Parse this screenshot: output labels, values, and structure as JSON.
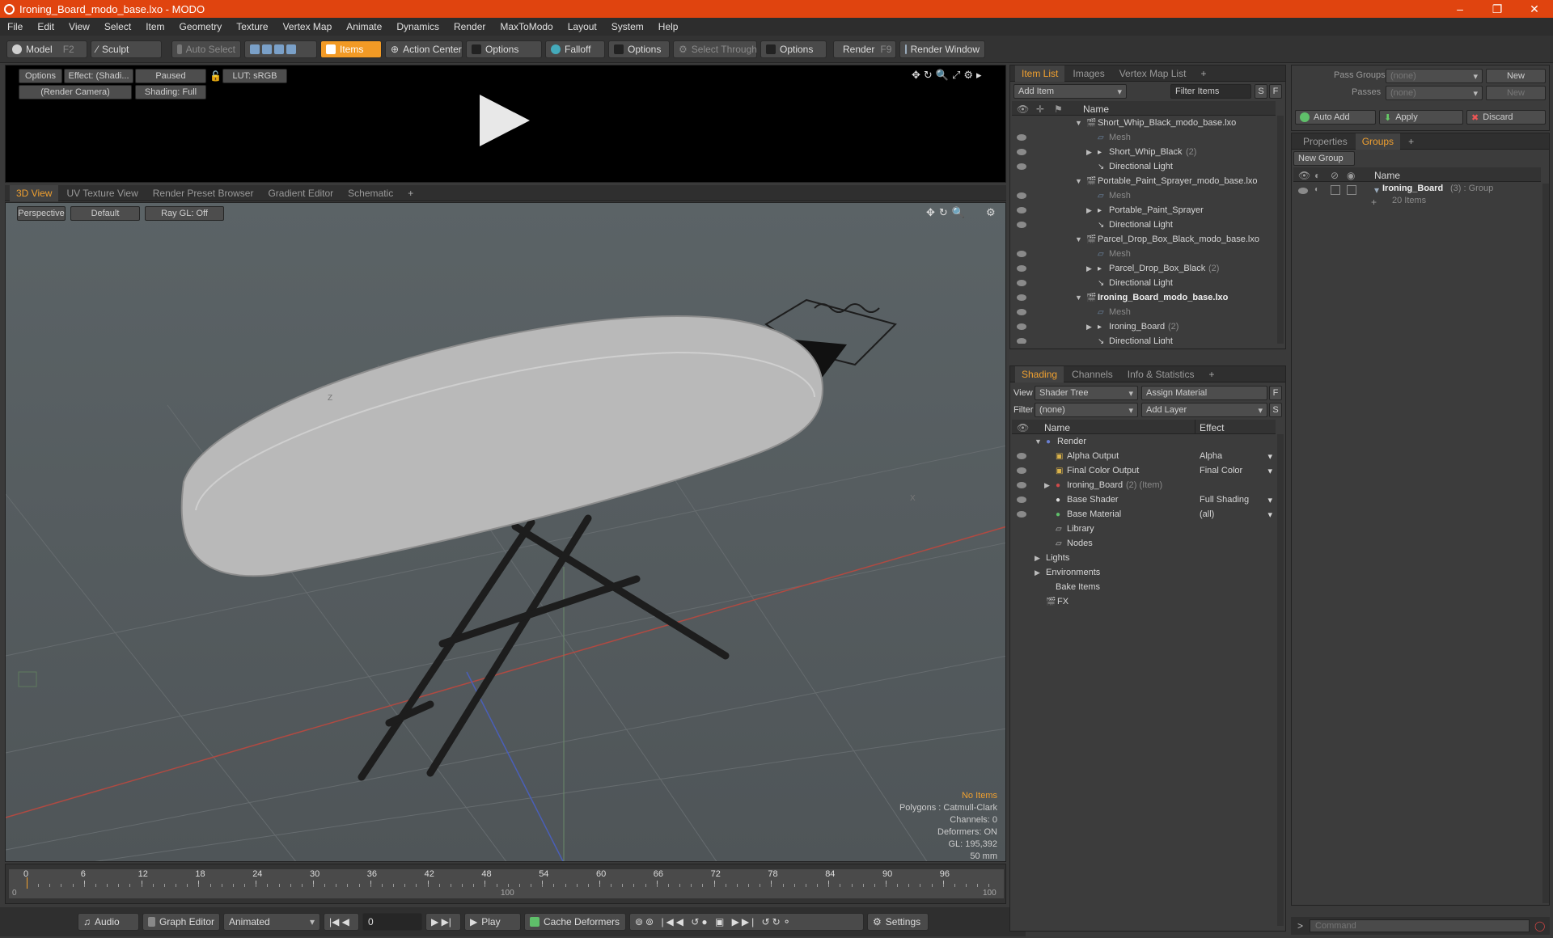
{
  "window": {
    "title": "Ironing_Board_modo_base.lxo - MODO",
    "min": "–",
    "max": "❐",
    "close": "✕"
  },
  "menu": [
    "File",
    "Edit",
    "View",
    "Select",
    "Item",
    "Geometry",
    "Texture",
    "Vertex Map",
    "Animate",
    "Dynamics",
    "Render",
    "MaxToModo",
    "Layout",
    "System",
    "Help"
  ],
  "toolbar": {
    "model": "Model",
    "model_key": "F2",
    "sculpt": "Sculpt",
    "auto_select": "Auto Select",
    "items": "Items",
    "action_center": "Action Center",
    "options1": "Options",
    "falloff": "Falloff",
    "options2": "Options",
    "select_through": "Select Through",
    "options3": "Options",
    "render": "Render",
    "render_key": "F9",
    "render_window": "Render Window"
  },
  "preview": {
    "options": "Options",
    "effect": "Effect: (Shadi...",
    "paused": "Paused",
    "lut": "LUT: sRGB",
    "camera": "(Render Camera)",
    "shading": "Shading: Full"
  },
  "viewport": {
    "tabs": [
      "3D View",
      "UV Texture View",
      "Render Preset Browser",
      "Gradient Editor",
      "Schematic"
    ],
    "plus": "+",
    "perspective": "Perspective",
    "default": "Default",
    "raygl": "Ray GL: Off",
    "axis_z": "Z",
    "axis_x": "X",
    "hud": {
      "no_items": "No Items",
      "polygons": "Polygons : Catmull-Clark",
      "channels": "Channels: 0",
      "deformers": "Deformers: ON",
      "gl": "GL: 195,392",
      "mm": "50 mm"
    }
  },
  "timeline": {
    "ticks": [
      "0",
      "6",
      "12",
      "18",
      "24",
      "30",
      "36",
      "42",
      "48",
      "54",
      "60",
      "66",
      "72",
      "78",
      "84",
      "90",
      "96"
    ],
    "bottom": [
      "0",
      "100",
      "100"
    ]
  },
  "bottombar": {
    "audio": "Audio",
    "graph_editor": "Graph Editor",
    "animated": "Animated",
    "frame": "0",
    "play": "Play",
    "cache": "Cache Deformers",
    "settings": "Settings"
  },
  "itemlist": {
    "tabs": [
      "Item List",
      "Images",
      "Vertex Map List"
    ],
    "plus": "+",
    "add_item": "Add Item",
    "filter": "Filter Items",
    "s": "S",
    "f": "F",
    "col_name": "Name",
    "rows": [
      {
        "label": "Short_Whip_Black_modo_base.lxo",
        "level": 0,
        "type": "scene",
        "expand": "▼"
      },
      {
        "label": "Mesh",
        "level": 1,
        "type": "mesh",
        "expand": ""
      },
      {
        "label": "Short_Whip_Black",
        "count": "(2)",
        "level": 1,
        "type": "group",
        "expand": "▶"
      },
      {
        "label": "Directional Light",
        "level": 1,
        "type": "light",
        "expand": ""
      },
      {
        "label": "Portable_Paint_Sprayer_modo_base.lxo",
        "level": 0,
        "type": "scene",
        "expand": "▼"
      },
      {
        "label": "Mesh",
        "level": 1,
        "type": "mesh",
        "expand": ""
      },
      {
        "label": "Portable_Paint_Sprayer",
        "level": 1,
        "type": "group",
        "expand": "▶"
      },
      {
        "label": "Directional Light",
        "level": 1,
        "type": "light",
        "expand": ""
      },
      {
        "label": "Parcel_Drop_Box_Black_modo_base.lxo",
        "level": 0,
        "type": "scene",
        "expand": "▼"
      },
      {
        "label": "Mesh",
        "level": 1,
        "type": "mesh",
        "expand": ""
      },
      {
        "label": "Parcel_Drop_Box_Black",
        "count": "(2)",
        "level": 1,
        "type": "group",
        "expand": "▶"
      },
      {
        "label": "Directional Light",
        "level": 1,
        "type": "light",
        "expand": ""
      },
      {
        "label": "Ironing_Board_modo_base.lxo",
        "level": 0,
        "type": "scene",
        "expand": "▼",
        "bold": true
      },
      {
        "label": "Mesh",
        "level": 1,
        "type": "mesh",
        "expand": ""
      },
      {
        "label": "Ironing_Board",
        "count": "(2)",
        "level": 1,
        "type": "group",
        "expand": "▶"
      },
      {
        "label": "Directional Light",
        "level": 1,
        "type": "light",
        "expand": ""
      }
    ]
  },
  "shading": {
    "tabs": [
      "Shading",
      "Channels",
      "Info & Statistics"
    ],
    "plus": "+",
    "view_label": "View",
    "view_value": "Shader Tree",
    "assign_material": "Assign Material",
    "f": "F",
    "filter_label": "Filter",
    "filter_value": "(none)",
    "add_layer": "Add Layer",
    "s": "S",
    "col_name": "Name",
    "col_effect": "Effect",
    "rows": [
      {
        "label": "Render",
        "effect": "",
        "level": 0,
        "expand": "▼",
        "icon": "render"
      },
      {
        "label": "Alpha Output",
        "effect": "Alpha",
        "level": 1,
        "expand": "",
        "icon": "output"
      },
      {
        "label": "Final Color Output",
        "effect": "Final Color",
        "level": 1,
        "expand": "",
        "icon": "output"
      },
      {
        "label": "Ironing_Board",
        "extra": "(2) (Item)",
        "effect": "",
        "level": 1,
        "expand": "▶",
        "icon": "mask"
      },
      {
        "label": "Base Shader",
        "effect": "Full Shading",
        "level": 1,
        "expand": "",
        "icon": "shader"
      },
      {
        "label": "Base Material",
        "effect": "(all)",
        "level": 1,
        "expand": "",
        "icon": "material"
      },
      {
        "label": "Library",
        "effect": "",
        "level": 1,
        "expand": "",
        "icon": "folder"
      },
      {
        "label": "Nodes",
        "effect": "",
        "level": 1,
        "expand": "",
        "icon": "folder"
      },
      {
        "label": "Lights",
        "effect": "",
        "level": 0,
        "expand": "▶",
        "icon": ""
      },
      {
        "label": "Environments",
        "effect": "",
        "level": 0,
        "expand": "▶",
        "icon": ""
      },
      {
        "label": "Bake Items",
        "effect": "",
        "level": 0,
        "expand": "",
        "icon": ""
      },
      {
        "label": "FX",
        "effect": "",
        "level": 0,
        "expand": "",
        "icon": "fx"
      }
    ]
  },
  "passes": {
    "pass_groups": "Pass Groups",
    "passes": "Passes",
    "none1": "(none)",
    "none2": "(none)",
    "new1": "New",
    "new2": "New",
    "auto_add": "Auto Add",
    "apply": "Apply",
    "discard": "Discard"
  },
  "groups": {
    "tabs": [
      "Properties",
      "Groups"
    ],
    "plus": "+",
    "new_group": "New Group",
    "col_name": "Name",
    "group_name": "Ironing_Board",
    "group_count": "(3) : Group",
    "group_items": "20 Items"
  },
  "command": {
    "placeholder": "Command",
    "arrow": ">"
  }
}
